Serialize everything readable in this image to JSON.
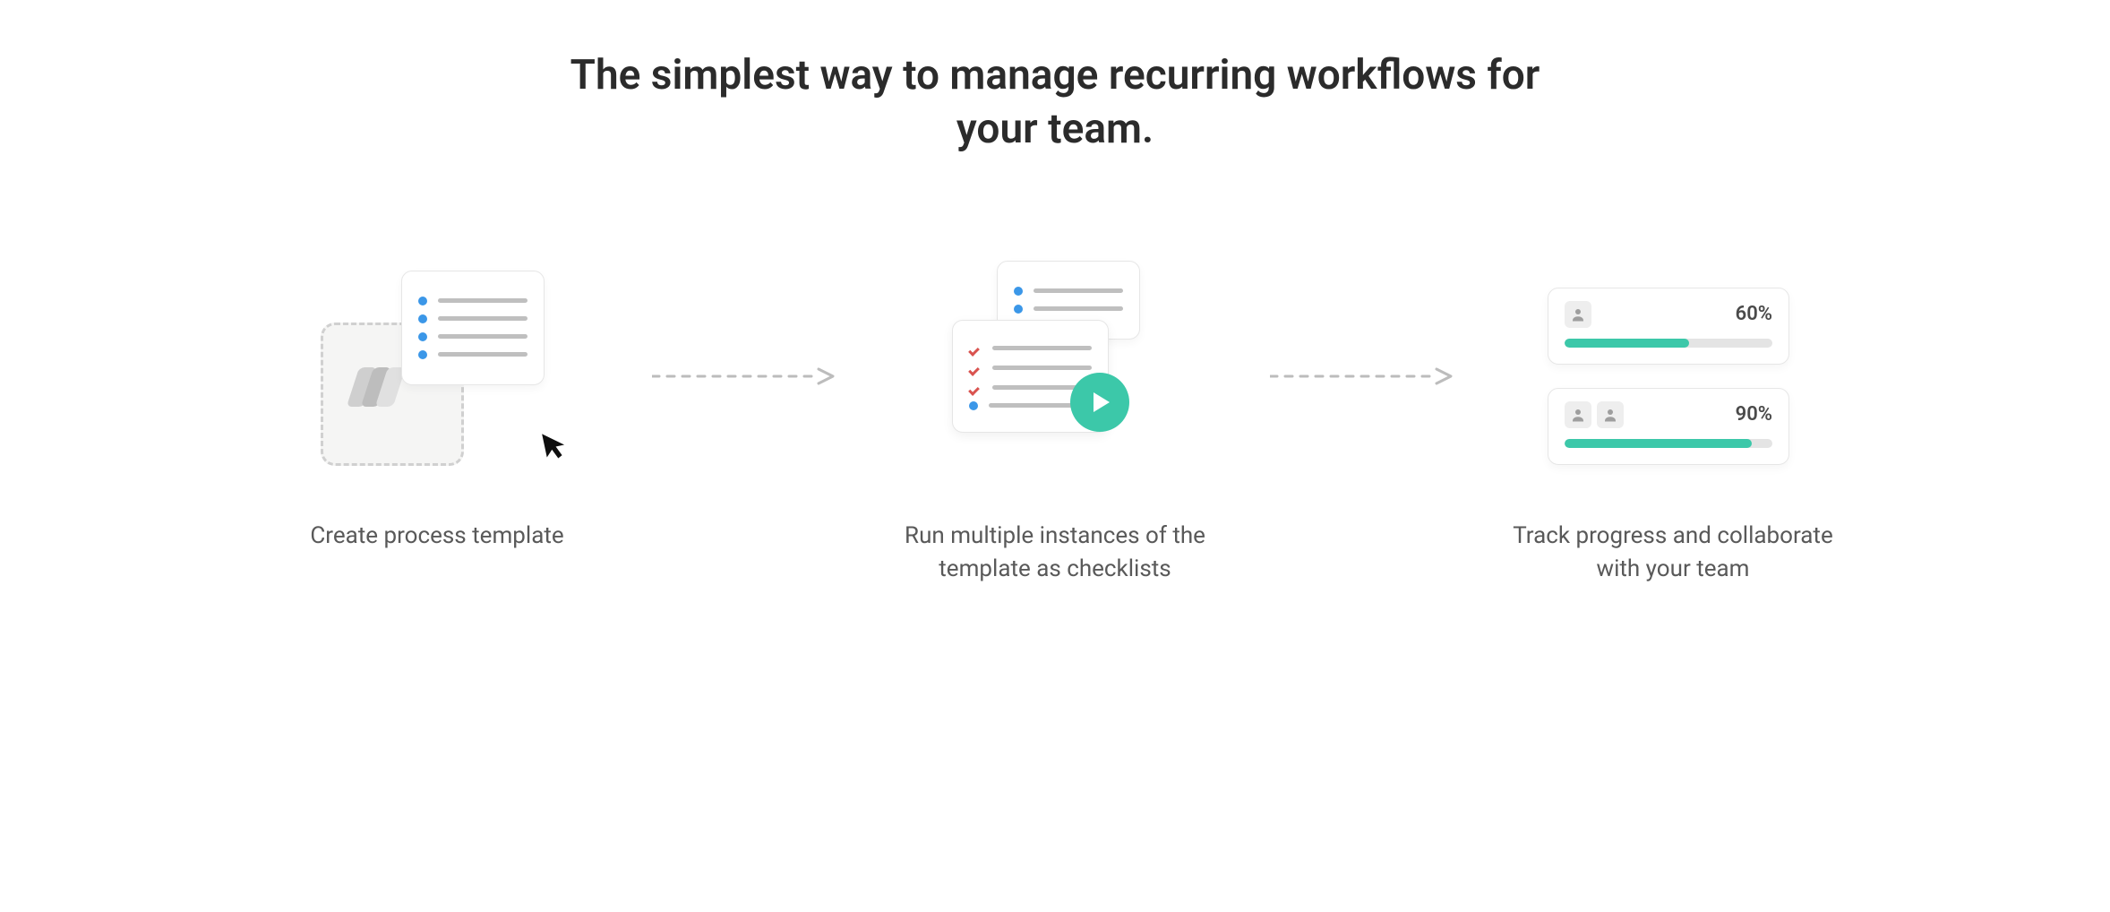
{
  "headline": "The simplest way to manage recurring workflows for your team.",
  "steps": [
    {
      "caption": "Create process template"
    },
    {
      "caption": "Run multiple instances of the template as checklists"
    },
    {
      "caption": "Track progress and collaborate with your team"
    }
  ],
  "progress": [
    {
      "percent_label": "60%",
      "percent_value": 60,
      "avatars": 1
    },
    {
      "percent_label": "90%",
      "percent_value": 90,
      "avatars": 2
    }
  ],
  "colors": {
    "accent_blue": "#3b97e8",
    "accent_teal": "#3cc8a9",
    "accent_red": "#d9534f",
    "text_dark": "#2b2b2b",
    "text_mid": "#595959",
    "line_grey": "#bfbfbf"
  }
}
